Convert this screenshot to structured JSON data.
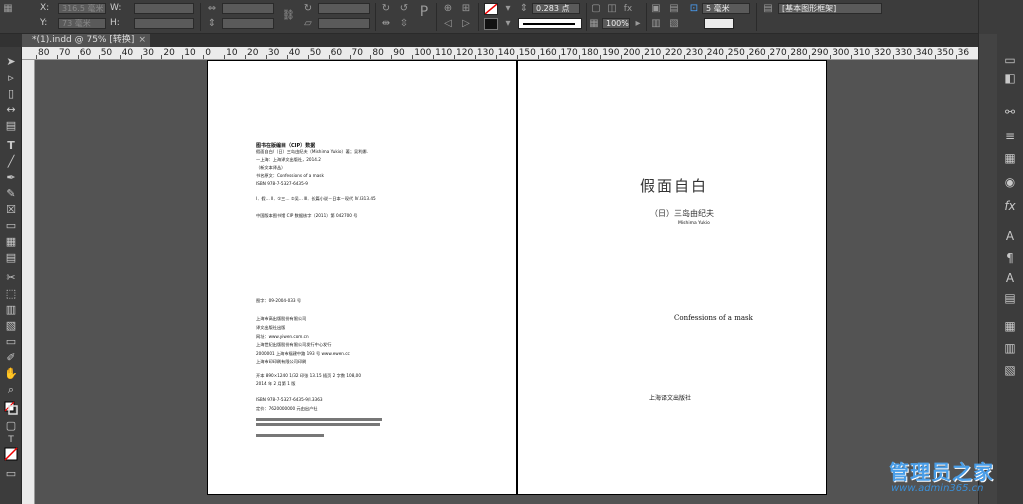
{
  "control_bar": {
    "x_label": "X:",
    "y_label": "Y:",
    "w_label": "W:",
    "h_label": "H:",
    "x_value": "316.5 毫米",
    "y_value": "73 毫米",
    "stroke_weight": "0.283 点",
    "opacity": "100%",
    "spacing": "5 毫米",
    "object_style": "[基本图形框架]"
  },
  "tab": {
    "title": "*(1).indd @ 75% [转换]",
    "close": "×"
  },
  "ruler": {
    "ticks": [
      "80",
      "70",
      "60",
      "50",
      "40",
      "30",
      "20",
      "10",
      "0",
      "10",
      "20",
      "30",
      "40",
      "50",
      "60",
      "70",
      "80",
      "90",
      "100",
      "110",
      "120",
      "130",
      "140",
      "150",
      "160",
      "170",
      "180",
      "190",
      "200",
      "210",
      "220",
      "230",
      "240",
      "250",
      "260",
      "270",
      "280",
      "290",
      "300",
      "310",
      "320",
      "330",
      "340",
      "350",
      "36"
    ]
  },
  "left_page": {
    "cip_title": "图书在版编目（CIP）数据",
    "cip_line1": "假面自白/（日）三岛由纪夫（Mishima Yukio）著；吴利娜.",
    "cip_line2": "—上海：上海译文出版社，2014.2",
    "cip_line3": "（新文本译丛）",
    "cip_line4": "书名原文：Confessions of a mask",
    "cip_line5": "ISBN 978-7-5327-6435-9",
    "cip_line6": "Ⅰ．假…  Ⅱ．①三…  ②吴…  Ⅲ．长篇小说－日本－现代  Ⅳ.Ⅰ313.45",
    "cip_line7": "中国版本图书馆 CIP 数据核字（2011）第 042700 号",
    "reg_no": "图字：09-2004-033 号",
    "pub_line1": "上海市高出版股份有限公司",
    "pub_line2": "译文出版社出版",
    "pub_line3": "网址：www.yiwen.com.cn",
    "pub_line4": "上海世纪出版股份有限公司发行中心发行",
    "pub_line5": "2000001  上海市福建中路 193 号  www.ewen.cc",
    "pub_line6": "上海市印印刷有限公司印刷",
    "spec_line1": "开本 890×1240  1/32  印张 13.15  插页 2  字数 108,00",
    "spec_line2": "2014 年 2 月第 1 版",
    "isbn_line1": "ISBN 978-7-5327-6435-9/I.3363",
    "isbn_line2": "定价：7620000000 元由出户社"
  },
  "right_page": {
    "title": "假面自白",
    "author_cn": "（日）三岛由纪夫",
    "author_en": "Mishima Yukio",
    "title_en": "Confessions of a mask",
    "publisher": "上海译文出版社"
  },
  "watermark": {
    "title": "管理员之家",
    "url": "www.admin365.cn"
  }
}
